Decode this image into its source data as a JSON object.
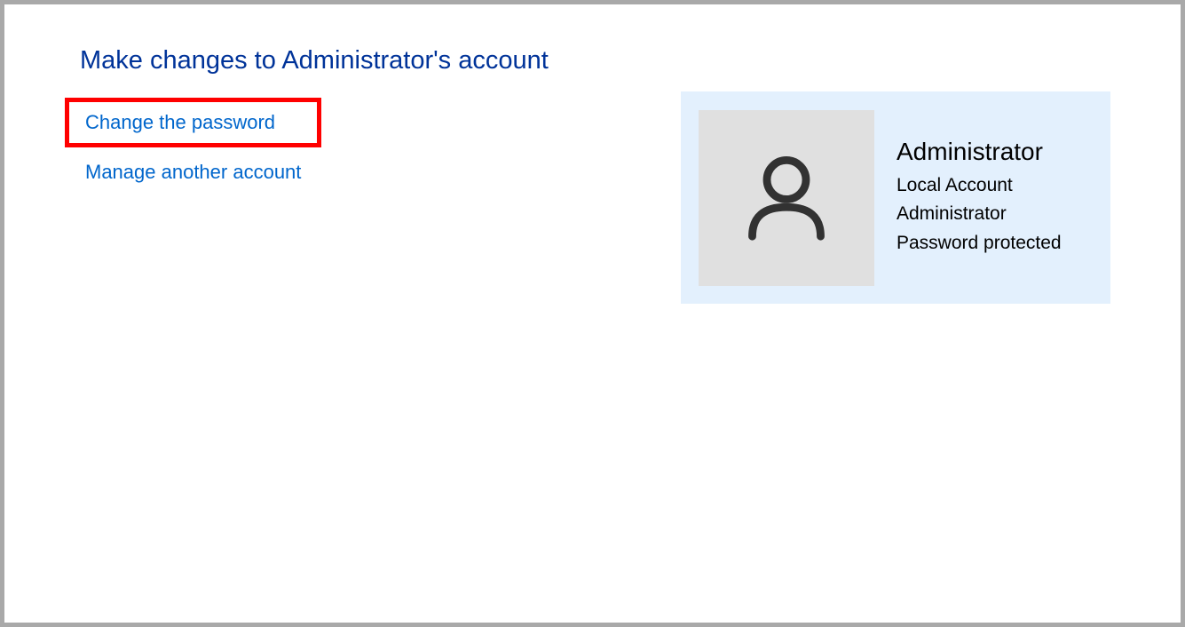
{
  "page": {
    "title": "Make changes to Administrator's account"
  },
  "links": {
    "change_password": "Change the password",
    "manage_another": "Manage another account"
  },
  "account": {
    "name": "Administrator",
    "type": "Local Account",
    "role": "Administrator",
    "protection": "Password protected"
  }
}
